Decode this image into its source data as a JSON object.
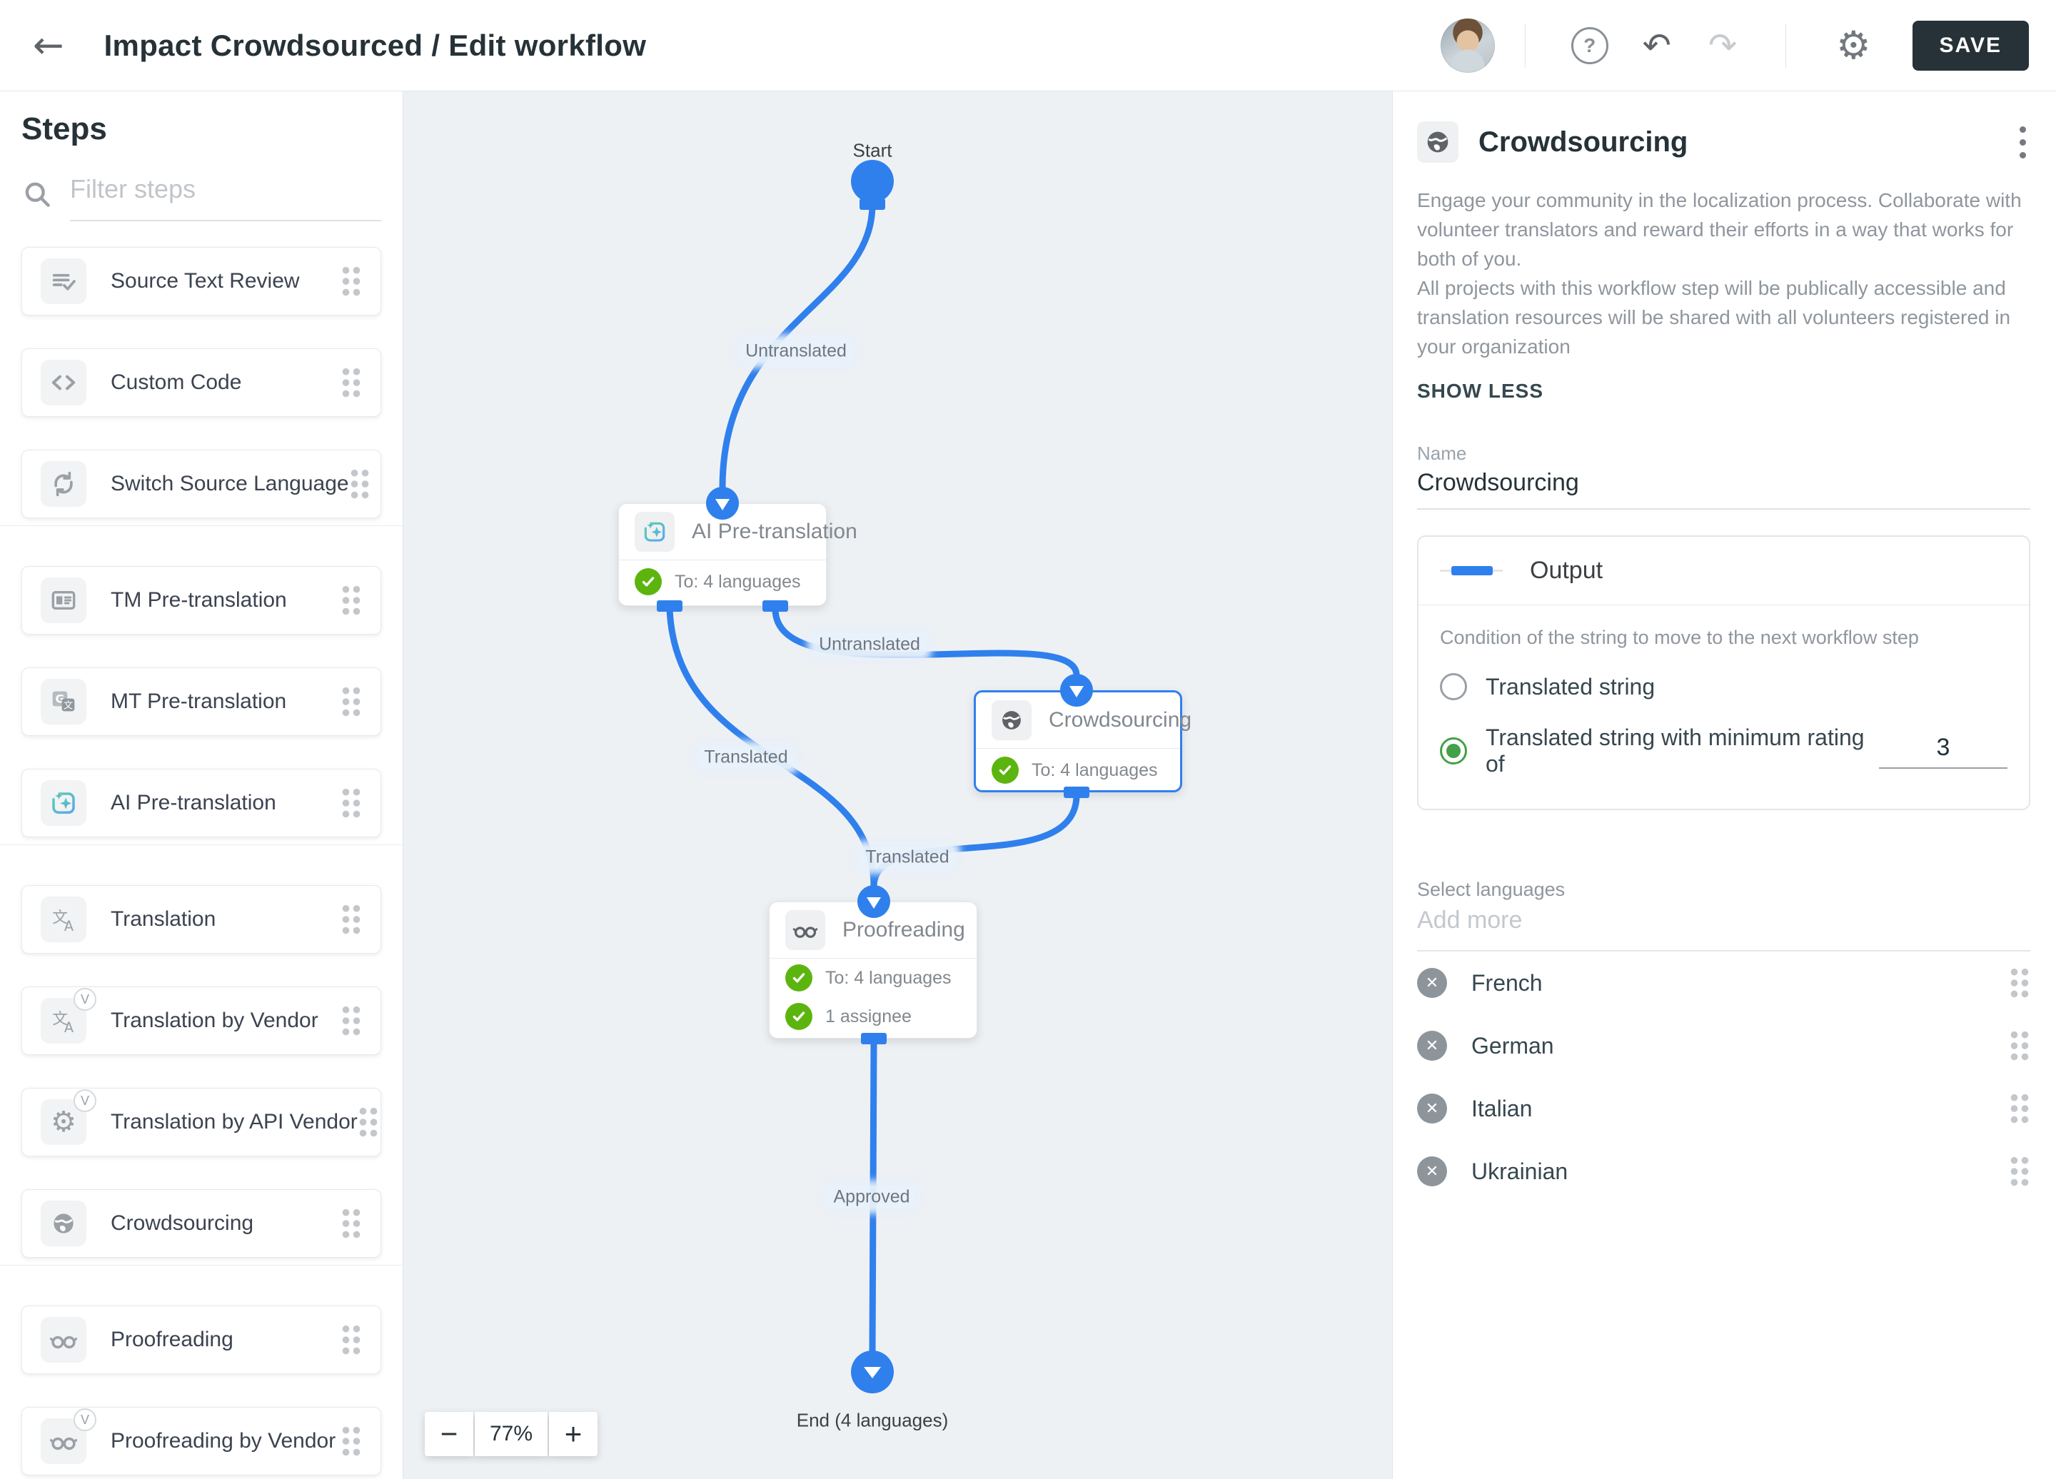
{
  "glyphs": {
    "back": "←",
    "help": "?",
    "undo": "↶",
    "redo": "↷",
    "gear": "⚙",
    "remove": "✕",
    "minus": "−",
    "plus": "+"
  },
  "header": {
    "title": "Impact Crowdsourced / Edit workflow",
    "save_label": "SAVE"
  },
  "sidebar": {
    "heading": "Steps",
    "filter_placeholder": "Filter steps",
    "vendor_badge": "V",
    "groups": [
      {
        "items": [
          {
            "label": "Source Text Review",
            "icon": "list-check-icon"
          },
          {
            "label": "Custom Code",
            "icon": "code-icon"
          },
          {
            "label": "Switch Source Language",
            "icon": "sync-icon"
          }
        ]
      },
      {
        "items": [
          {
            "label": "TM Pre-translation",
            "icon": "tm-card-icon"
          },
          {
            "label": "MT Pre-translation",
            "icon": "machine-translate-icon"
          },
          {
            "label": "AI Pre-translation",
            "icon": "ai-sparkle-icon"
          }
        ]
      },
      {
        "items": [
          {
            "label": "Translation",
            "icon": "translate-icon"
          },
          {
            "label": "Translation by Vendor",
            "icon": "translate-icon",
            "badge": "V"
          },
          {
            "label": "Translation by API Vendor",
            "icon": "gear-icon",
            "badge": "V"
          },
          {
            "label": "Crowdsourcing",
            "icon": "globe-icon"
          }
        ]
      },
      {
        "items": [
          {
            "label": "Proofreading",
            "icon": "glasses-icon"
          },
          {
            "label": "Proofreading by Vendor",
            "icon": "glasses-icon",
            "badge": "V"
          }
        ]
      }
    ]
  },
  "canvas": {
    "zoom": {
      "value": "77%"
    },
    "start": {
      "label": "Start"
    },
    "end": {
      "label": "End (4 languages)"
    },
    "nodes": {
      "ai": {
        "title": "AI Pre-translation",
        "to": "To: 4 languages"
      },
      "crowdsourcing": {
        "title": "Crowdsourcing",
        "to": "To: 4 languages"
      },
      "proofreading": {
        "title": "Proofreading",
        "to": "To: 4 languages",
        "assignee": "1 assignee"
      }
    },
    "edge_labels": [
      {
        "text": "Untranslated"
      },
      {
        "text": "Translated"
      },
      {
        "text": "Untranslated"
      },
      {
        "text": "Translated"
      },
      {
        "text": "Approved"
      }
    ],
    "colors": {
      "edge_blue": "#2f80ed",
      "check_green": "#5cb50f"
    }
  },
  "panel": {
    "title": "Crowdsourcing",
    "description_1": "Engage your community in the localization process. Collaborate with volunteer translators and reward their efforts in a way that works for both of you.",
    "description_2": "All projects with this workflow step will be publically accessible and translation resources will be shared with all volunteers registered in your organization",
    "show_less": "SHOW LESS",
    "name": {
      "label": "Name",
      "value": "Crowdsourcing"
    },
    "output": {
      "title": "Output",
      "condition": "Condition of the string to move to the next workflow step",
      "options": [
        {
          "label": "Translated string",
          "selected": false
        },
        {
          "label": "Translated string with minimum rating of",
          "selected": true,
          "rating": "3"
        }
      ]
    },
    "languages": {
      "label": "Select languages",
      "placeholder": "Add more",
      "items": [
        {
          "name": "French"
        },
        {
          "name": "German"
        },
        {
          "name": "Italian"
        },
        {
          "name": "Ukrainian"
        }
      ]
    }
  }
}
